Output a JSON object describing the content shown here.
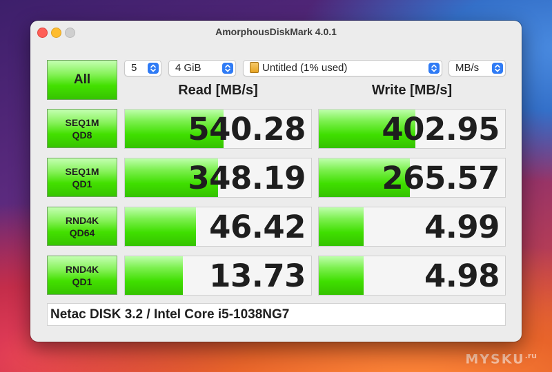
{
  "window": {
    "title": "AmorphousDiskMark 4.0.1"
  },
  "controls": {
    "all_label": "All",
    "count": "5",
    "size": "4 GiB",
    "disk": "Untitled (1% used)",
    "unit": "MB/s"
  },
  "headers": {
    "read": "Read [MB/s]",
    "write": "Write [MB/s]"
  },
  "tests": [
    {
      "line1": "SEQ1M",
      "line2": "QD8",
      "read": "540.28",
      "write": "402.95",
      "read_fill": 0.53,
      "write_fill": 0.52
    },
    {
      "line1": "SEQ1M",
      "line2": "QD1",
      "read": "348.19",
      "write": "265.57",
      "read_fill": 0.5,
      "write_fill": 0.49
    },
    {
      "line1": "RND4K",
      "line2": "QD64",
      "read": "46.42",
      "write": "4.99",
      "read_fill": 0.38,
      "write_fill": 0.24
    },
    {
      "line1": "RND4K",
      "line2": "QD1",
      "read": "13.73",
      "write": "4.98",
      "read_fill": 0.31,
      "write_fill": 0.24
    }
  ],
  "comment": "Netac DISK 3.2 / Intel Core i5-1038NG7",
  "watermark": {
    "text": "MYSKU",
    "suffix": ".ru"
  }
}
